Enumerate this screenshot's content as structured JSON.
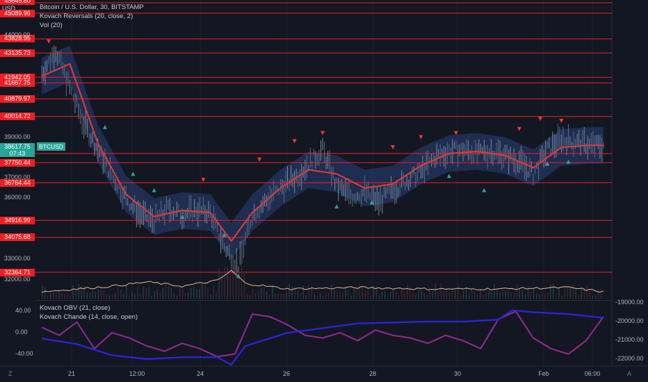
{
  "header": {
    "title": "Bitcoin / U.S. Dollar, 30, BITSTAMP",
    "indicator1": "Kovach Reversals (20, close, 2)",
    "indicator2": "Vol (20)",
    "currency": "USD"
  },
  "lower_pane": {
    "indicator1": "Kovach OBV (21, close)",
    "indicator2": "Kovach Chande (14, close, open)"
  },
  "price_tag": {
    "price": "38617.75",
    "countdown": "07:43",
    "symbol": "BTCUSD"
  },
  "levels": [
    "45089.96",
    "43828.95",
    "43135.73",
    "41942.05",
    "41667.75",
    "40879.97",
    "40014.72",
    "38200.00",
    "37750.44",
    "36764.44",
    "34916.99",
    "34075.68",
    "32364.71"
  ],
  "top_partial_level": "45645.80",
  "left_axis_labels": [
    "44000.00",
    "39000.00",
    "37000.00",
    "36000.00",
    "33000.00",
    "32000.00"
  ],
  "lower_left_axis": [
    "40.00",
    "0.00",
    "-40.00"
  ],
  "right_axis": [
    "-19000.00",
    "-20000.00",
    "-21000.00",
    "-22000.00"
  ],
  "time_axis": [
    "21",
    "12:00",
    "24",
    "26",
    "28",
    "30",
    "Feb",
    "06:00"
  ],
  "corner_left": "Z",
  "corner_right": "A",
  "colors": {
    "background": "#131722",
    "level_line": "#f21d23",
    "price_tag": "#26a69a",
    "up_arrow": "#26a69a",
    "down_arrow": "#f23645",
    "obv": "#2a24d6",
    "chande": "#8a2a87",
    "ma": "#d83a3a",
    "band": "#2c4a8a",
    "volume_ma": "#e8b48a"
  },
  "chart_data": {
    "type": "line",
    "title": "Bitcoin / U.S. Dollar, 30, BITSTAMP",
    "series": [
      {
        "name": "price",
        "x": [
          0,
          4,
          8,
          12,
          16,
          20,
          24,
          28,
          32,
          36,
          40,
          44,
          48,
          52,
          56,
          60,
          64,
          68,
          72,
          76,
          80,
          84,
          88,
          92,
          96,
          100,
          104,
          108,
          112,
          116,
          120,
          124,
          128,
          132,
          136,
          140,
          144,
          148,
          152,
          156,
          160
        ],
        "values": [
          42100,
          43300,
          41400,
          39600,
          38400,
          37100,
          36000,
          35200,
          34900,
          35500,
          35200,
          35400,
          35300,
          33600,
          32700,
          35200,
          35900,
          36500,
          37000,
          37700,
          38400,
          36600,
          36100,
          36300,
          35800,
          36400,
          36900,
          37300,
          38000,
          38300,
          38400,
          38200,
          38300,
          38100,
          37800,
          37200,
          38400,
          38900,
          38800,
          38600,
          38617.75
        ]
      },
      {
        "name": "ma",
        "x": [
          0,
          8,
          16,
          24,
          32,
          40,
          48,
          54,
          60,
          68,
          76,
          84,
          92,
          100,
          108,
          116,
          124,
          132,
          140,
          148,
          156,
          160
        ],
        "values": [
          42000,
          42600,
          38700,
          36200,
          35100,
          35400,
          35300,
          33900,
          35300,
          36500,
          37400,
          37200,
          36500,
          36700,
          37600,
          38200,
          38300,
          38100,
          37500,
          38500,
          38600,
          38600
        ]
      },
      {
        "name": "volume_ma",
        "x": [
          0,
          10,
          20,
          30,
          40,
          50,
          54,
          58,
          70,
          90,
          110,
          130,
          150,
          160
        ],
        "values": [
          0.2,
          0.3,
          0.4,
          0.55,
          0.4,
          0.6,
          0.95,
          0.5,
          0.3,
          0.35,
          0.3,
          0.3,
          0.35,
          0.2
        ]
      },
      {
        "name": "obv",
        "x": [
          0,
          10,
          20,
          30,
          40,
          50,
          54,
          58,
          70,
          90,
          110,
          120,
          130,
          134,
          140,
          150,
          160
        ],
        "values": [
          -20900,
          -21200,
          -21800,
          -22000,
          -21900,
          -21900,
          -22300,
          -21300,
          -20600,
          -20100,
          -20000,
          -20000,
          -19900,
          -19400,
          -19500,
          -19600,
          -19800
        ]
      },
      {
        "name": "chande",
        "x": [
          0,
          5,
          10,
          15,
          20,
          25,
          30,
          35,
          40,
          45,
          50,
          55,
          60,
          65,
          70,
          75,
          80,
          85,
          90,
          95,
          100,
          105,
          110,
          115,
          120,
          125,
          130,
          135,
          140,
          145,
          150,
          155,
          160
        ],
        "values": [
          10,
          -5,
          20,
          -30,
          0,
          -10,
          -25,
          -35,
          -20,
          -30,
          -45,
          -40,
          35,
          30,
          15,
          -5,
          -10,
          0,
          -15,
          5,
          -5,
          -10,
          -20,
          -5,
          -15,
          -30,
          25,
          40,
          -10,
          -30,
          -40,
          -15,
          30
        ]
      }
    ],
    "ylim": [
      32000,
      45700
    ],
    "lower_ylim": [
      -60,
      60
    ]
  }
}
